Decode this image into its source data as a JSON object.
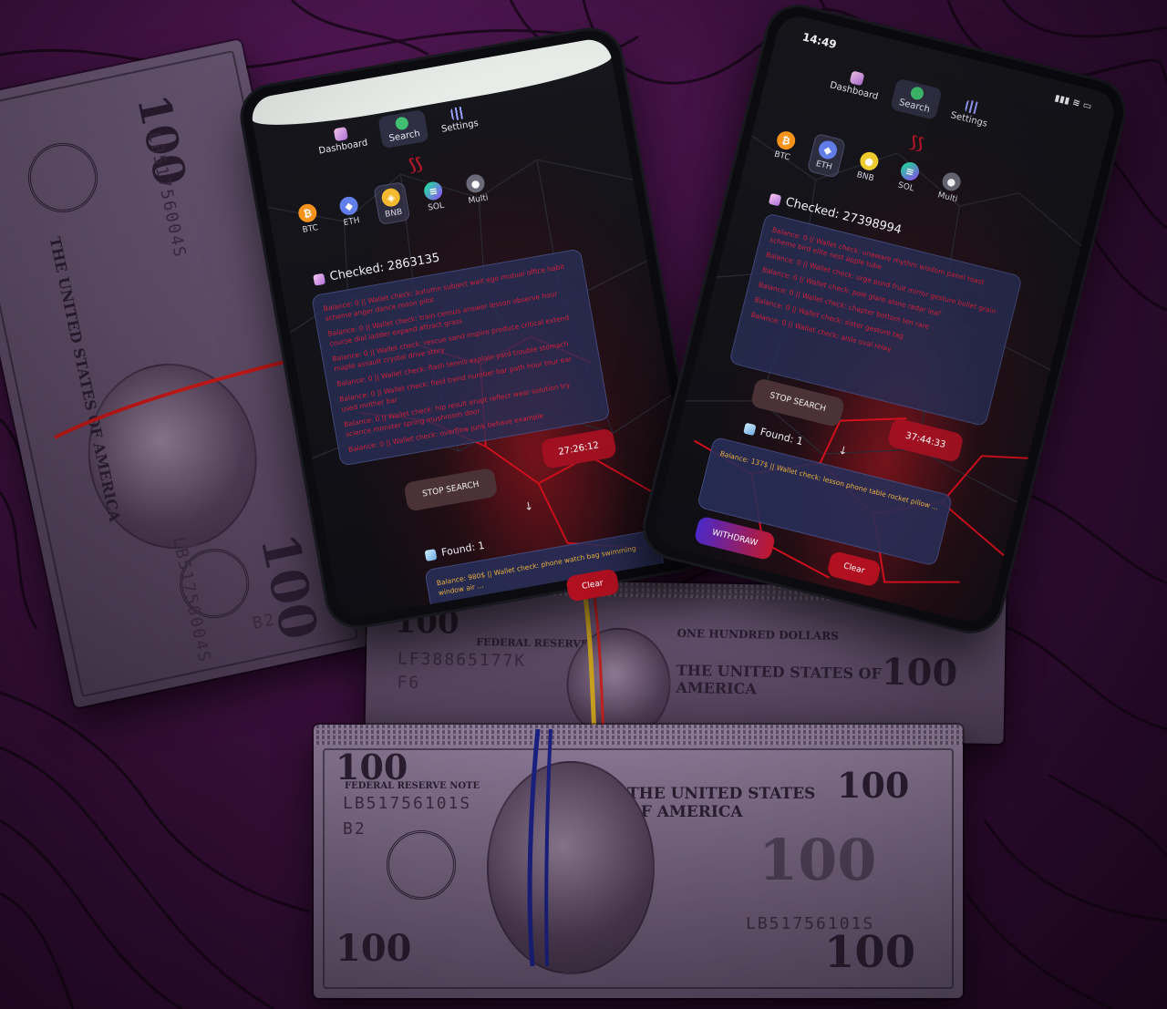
{
  "phone_left": {
    "nav": [
      {
        "label": "Dashboard",
        "icon": "dashboard-icon"
      },
      {
        "label": "Search",
        "icon": "search-icon"
      },
      {
        "label": "Settings",
        "icon": "settings-icon"
      }
    ],
    "coins": [
      {
        "label": "BTC",
        "symbol": "₿",
        "color": "#f7931a"
      },
      {
        "label": "ETH",
        "symbol": "◆",
        "color": "#627eea"
      },
      {
        "label": "BNB",
        "symbol": "◈",
        "color": "#f3ba2f"
      },
      {
        "label": "SOL",
        "symbol": "≡",
        "color": "#9945ff"
      },
      {
        "label": "Multi",
        "symbol": "●",
        "color": "#e05050"
      }
    ],
    "active_coin": "BNB",
    "checked": "Checked: 2863135",
    "log_lines": [
      "Balance: 0 || Wallet check: autumn subject wait ego mutual office habit scheme anger dance moon pilot",
      "Balance: 0 || Wallet check: train census answer lesson observe hour course dial ladder expand attract grass",
      "Balance: 0 || Wallet check: rescue sand inspire produce critical extend maple assault crystal drive story",
      "Balance: 0 || Wallet check: flash tennis explain yard trouble stomach",
      "Balance: 0 || Wallet check: field trend number bar path hour tour ear used mother bar",
      "Balance: 0 || Wallet check: hip result erupt reflect wear solution try science monster spring mushroom door",
      "Balance: 0 || Wallet check: overflow junk behave example"
    ],
    "timer": "27:26:12",
    "stop_label": "STOP SEARCH",
    "arrow": "↓",
    "found": "Found: 1",
    "found_text": "Balance: 980$ || Wallet check: phone watch bag swimming window air ...",
    "clear_label": "Clear"
  },
  "phone_right": {
    "time": "14:49",
    "nav": [
      {
        "label": "Dashboard",
        "icon": "dashboard-icon"
      },
      {
        "label": "Search",
        "icon": "search-icon"
      },
      {
        "label": "Settings",
        "icon": "settings-icon"
      }
    ],
    "coins": [
      {
        "label": "BTC",
        "symbol": "₿",
        "color": "#f7931a"
      },
      {
        "label": "ETH",
        "symbol": "◆",
        "color": "#627eea"
      },
      {
        "label": "BNB",
        "symbol": "●",
        "color": "#f3d02f"
      },
      {
        "label": "SOL",
        "symbol": "≡",
        "color": "#9945ff"
      },
      {
        "label": "Multi",
        "symbol": "●",
        "color": "#e05050"
      }
    ],
    "active_coin": "ETH",
    "checked": "Checked: 27398994",
    "log_lines": [
      "Balance: 0 || Wallet check: unaware rhythm wisdom panel toast scheme bird elite nest apple tube",
      "Balance: 0 || Wallet check: urge pond fruit mirror gesture bullet grain",
      "Balance: 0 || Wallet check: pole glare alone radar leaf",
      "Balance: 0 || Wallet check: chapter bottom ten rare",
      "Balance: 0 || Wallet check: sister gesture tag",
      "Balance: 0 || Wallet check: aisle oval relay"
    ],
    "timer": "37:44:33",
    "stop_label": "STOP SEARCH",
    "arrow": "↓",
    "found": "Found: 1",
    "found_text": "Balance: 137$ || Wallet check: lesson phone table rocket pillow ...",
    "withdraw_label": "WITHDRAW",
    "clear_label": "Clear"
  },
  "bills": {
    "denomination": "100",
    "serial_left_top": "LB51756004S",
    "serial_left_bottom": "LB51756004S",
    "plate_left": "B2",
    "serial_mid": "LF38865177K",
    "plate_mid": "F6",
    "serial_front": "LB51756101S",
    "plate_front": "B2",
    "serial_front_right": "LB51756101S",
    "text_usa": "THE UNITED STATES OF AMERICA",
    "text_one_hundred": "ONE HUNDRED DOLLARS",
    "text_fed": "FEDERAL RESERVE NOTE"
  },
  "colors": {
    "background": "#3a0f3c",
    "accent_red": "#b01020",
    "panel_blue": "#282e56"
  }
}
